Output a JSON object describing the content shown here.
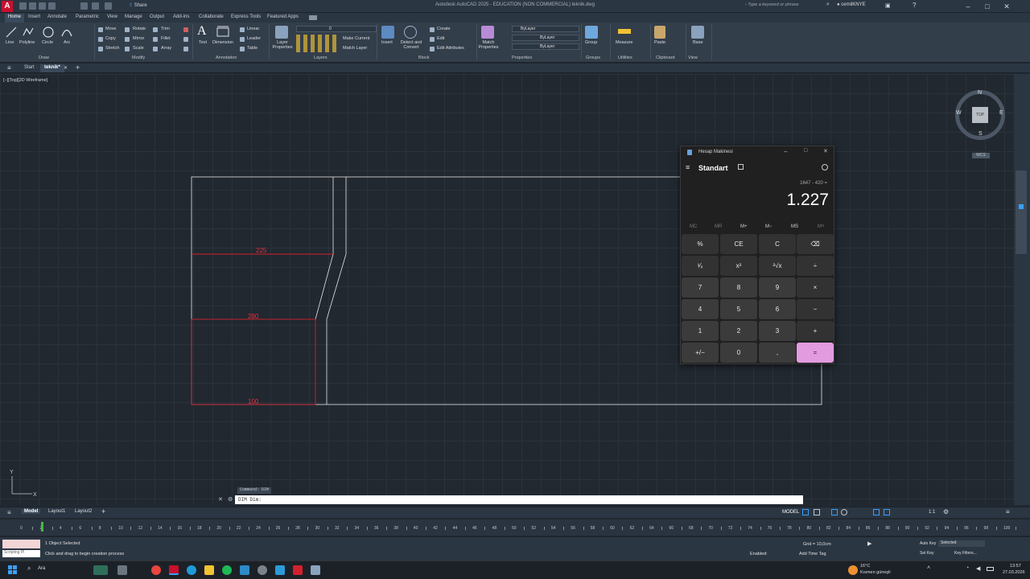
{
  "app": {
    "title": "Autodesk AutoCAD 2025 - EDUCATION (NON COMMERCIAL)   teknik.dwg",
    "share_label": "Share",
    "search_placeholder": "Type a keyword or phrase",
    "user": "cemilKNYE"
  },
  "ribbon_tabs": [
    "Home",
    "Insert",
    "Annotate",
    "Parametric",
    "View",
    "Manage",
    "Output",
    "Add-ins",
    "Collaborate",
    "Express Tools",
    "Featured Apps"
  ],
  "ribbon": {
    "draw": {
      "label": "Draw",
      "tools": [
        "Line",
        "Polyline",
        "Circle",
        "Arc"
      ]
    },
    "modify": {
      "label": "Modify",
      "tools": [
        "Move",
        "Rotate",
        "Trim",
        "Copy",
        "Mirror",
        "Fillet",
        "Stretch",
        "Scale",
        "Array"
      ]
    },
    "annotation": {
      "label": "Annotation",
      "tools": [
        "Text",
        "Dimension",
        "Linear",
        "Leader",
        "Table"
      ]
    },
    "layers": {
      "label": "Layers",
      "tools": [
        "Layer Properties",
        "Make Current",
        "Match Layer"
      ],
      "current_layer": "0"
    },
    "block": {
      "label": "Block",
      "tools": [
        "Insert",
        "Create",
        "Edit",
        "Edit Attributes"
      ]
    },
    "properties": {
      "label": "Properties",
      "tools": [
        "Match Properties"
      ],
      "color": "ByLayer",
      "linetype": "ByLayer",
      "lineweight": "ByLayer"
    },
    "groups": {
      "label": "Groups",
      "tools": [
        "Group"
      ]
    },
    "utilities": {
      "label": "Utilities",
      "tools": [
        "Measure"
      ]
    },
    "clipboard": {
      "label": "Clipboard",
      "tools": [
        "Paste"
      ]
    },
    "view": {
      "label": "View",
      "tools": [
        "Base"
      ]
    },
    "extra": [
      "Detect and Convert"
    ]
  },
  "file_tabs": [
    "Start",
    "teknik*"
  ],
  "viewport_label": "[−][Top][2D Wireframe]",
  "viewcube": {
    "n": "N",
    "s": "S",
    "e": "E",
    "w": "W",
    "top": "TOP",
    "wcs": "WCS"
  },
  "drawing": {
    "dim1": "225",
    "dim2": "280",
    "dim3": "100"
  },
  "calculator": {
    "window_title": "Hesap Makinesi",
    "mode": "Standart",
    "expression": "1647 - 420 =",
    "result": "1.227",
    "memory": [
      "MC",
      "MR",
      "M+",
      "M−",
      "MS",
      "M˅"
    ],
    "keys": [
      [
        "%",
        "CE",
        "C",
        "⌫"
      ],
      [
        "¹⁄ₓ",
        "x²",
        "²√x",
        "÷"
      ],
      [
        "7",
        "8",
        "9",
        "×"
      ],
      [
        "4",
        "5",
        "6",
        "−"
      ],
      [
        "1",
        "2",
        "3",
        "+"
      ],
      [
        "+/−",
        "0",
        ",",
        "="
      ]
    ]
  },
  "command": {
    "history": "Command: DIM",
    "prompt": "DIM Dim:"
  },
  "layout_tabs": [
    "Model",
    "Layout1",
    "Layout2"
  ],
  "status": {
    "model_label": "MODEL",
    "scale": "1:1"
  },
  "timeline_ticks": [
    "0",
    "2",
    "4",
    "6",
    "8",
    "10",
    "12",
    "14",
    "16",
    "18",
    "20",
    "22",
    "24",
    "26",
    "28",
    "30",
    "32",
    "34",
    "36",
    "38",
    "40",
    "42",
    "44",
    "46",
    "48",
    "50",
    "52",
    "54",
    "56",
    "58",
    "60",
    "62",
    "64",
    "66",
    "68",
    "70",
    "72",
    "74",
    "76",
    "78",
    "80",
    "82",
    "84",
    "86",
    "88",
    "90",
    "92",
    "94",
    "96",
    "98",
    "100"
  ],
  "anim": {
    "selection_text": "1 Object Selected",
    "hint_text": "Click and drag to begin creation process",
    "scripting_label": "Scripting Pl",
    "grid_text": "Grid = 10,0cm",
    "enabled_label": "Enabled:",
    "add_time_tag": "Add Time Tag",
    "auto_key": "Auto Key",
    "set_key": "Set Key",
    "key_mode": "Selected",
    "key_filters": "Key Filters..."
  },
  "taskbar": {
    "search_placeholder": "Ara",
    "weather_temp": "16°C",
    "weather_desc": "Kısmen güneşli",
    "time": "13:57",
    "date": "27.03.2026"
  },
  "colors": {
    "accent_red": "#c8102e",
    "calc_equal": "#e39be0",
    "canvas_bg": "#212830"
  }
}
